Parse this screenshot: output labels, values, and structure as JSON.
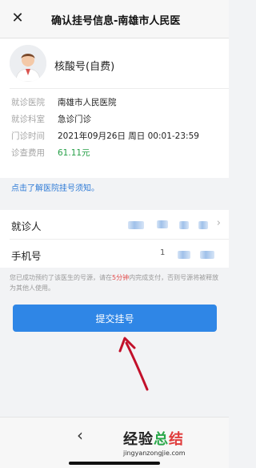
{
  "header": {
    "close_icon": "close-icon",
    "title": "确认挂号信息-南雄市人民医"
  },
  "doctor": {
    "avatar_icon": "doctor-avatar",
    "service_name": "核酸号(自费)"
  },
  "info": [
    {
      "label": "就诊医院",
      "value": "南雄市人民医院"
    },
    {
      "label": "就诊科室",
      "value": "急诊门诊"
    },
    {
      "label": "门诊时间",
      "value": "2021年09月26日 周日 00:01-23:59"
    },
    {
      "label": "诊查费用",
      "value": "61.11元"
    }
  ],
  "notice_link": "点击了解医院挂号须知。",
  "patient": {
    "name_label": "就诊人",
    "phone_label": "手机号",
    "phone_prefix": "1",
    "chevron_icon": "chevron-right-icon"
  },
  "hint": {
    "before": "您已成功预约了该医生的号源，请在",
    "emphasis": "5分钟",
    "after": "内完成支付，否则号源将被释放为其他人使用。"
  },
  "submit_label": "提交挂号",
  "bottom": {
    "back_icon": "chevron-left-icon"
  },
  "watermark": {
    "cn_1": "经验",
    "cn_2": "总",
    "cn_3": "结",
    "en": "jingyanzongjie.com"
  },
  "colors": {
    "accent": "#2f86e6",
    "fee": "#27a048",
    "link": "#2f7bd6",
    "warning": "#e04848"
  }
}
